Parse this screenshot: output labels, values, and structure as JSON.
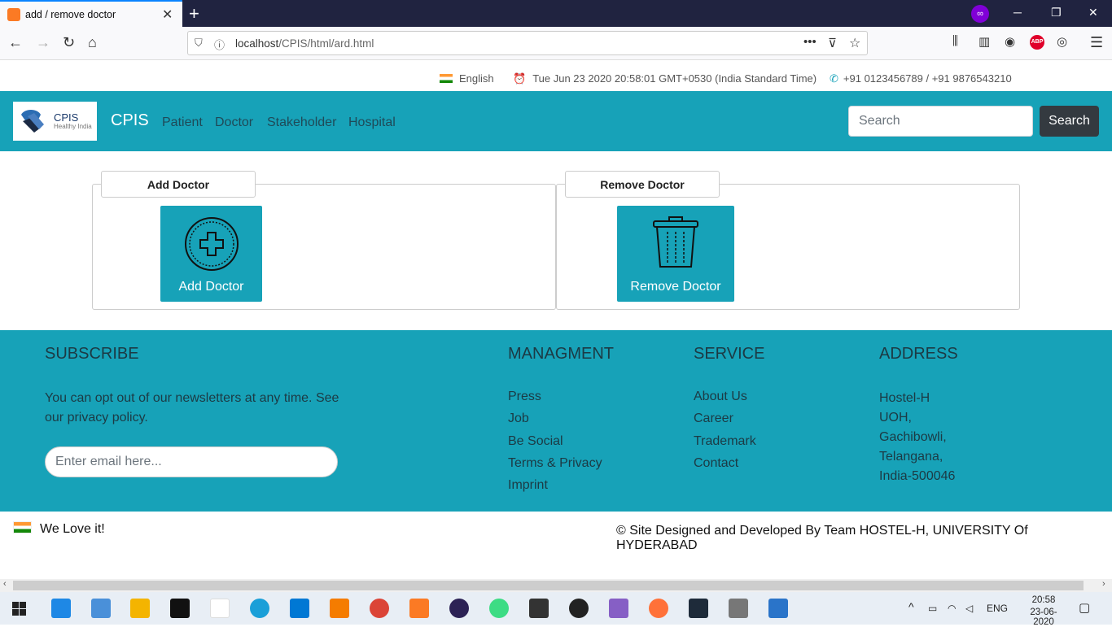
{
  "browser": {
    "tab_title": "add / remove doctor",
    "url_host": "localhost",
    "url_path": "/CPIS/html/ard.html"
  },
  "infobar": {
    "language": "English",
    "datetime": "Tue Jun 23 2020 20:58:01 GMT+0530 (India Standard Time)",
    "phone": "+91 0123456789 / +91 9876543210"
  },
  "site": {
    "logo_title": "CPIS",
    "logo_subtitle": "Healthy India",
    "brand": "CPIS",
    "nav": [
      "Patient",
      "Doctor",
      "Stakeholder",
      "Hospital"
    ],
    "search_placeholder": "Search",
    "search_button": "Search"
  },
  "main": {
    "add_legend": "Add Doctor",
    "add_tile": "Add Doctor",
    "remove_legend": "Remove Doctor",
    "remove_tile": "Remove Doctor"
  },
  "footer": {
    "subscribe_heading": "SUBSCRIBE",
    "subscribe_text": "You can opt out of our newsletters at any time. See our privacy policy.",
    "email_placeholder": "Enter email here...",
    "management_heading": "MANAGMENT",
    "management_links": [
      "Press",
      "Job",
      "Be Social",
      "Terms & Privacy",
      "Imprint"
    ],
    "service_heading": "SERVICE",
    "service_links": [
      "About Us",
      "Career",
      "Trademark",
      "Contact"
    ],
    "address_heading": "ADDRESS",
    "address_lines": [
      "Hostel-H",
      "UOH,",
      "Gachibowli,",
      "Telangana,",
      "India-500046"
    ]
  },
  "bottom": {
    "love": "We Love it!",
    "credit": "© Site Designed and Developed By Team HOSTEL-H, UNIVERSITY Of HYDERABAD"
  },
  "taskbar": {
    "language": "ENG",
    "time": "20:58",
    "date": "23-06-2020"
  },
  "colors": {
    "primary": "#17a2b8",
    "dark_button": "#343a40"
  }
}
